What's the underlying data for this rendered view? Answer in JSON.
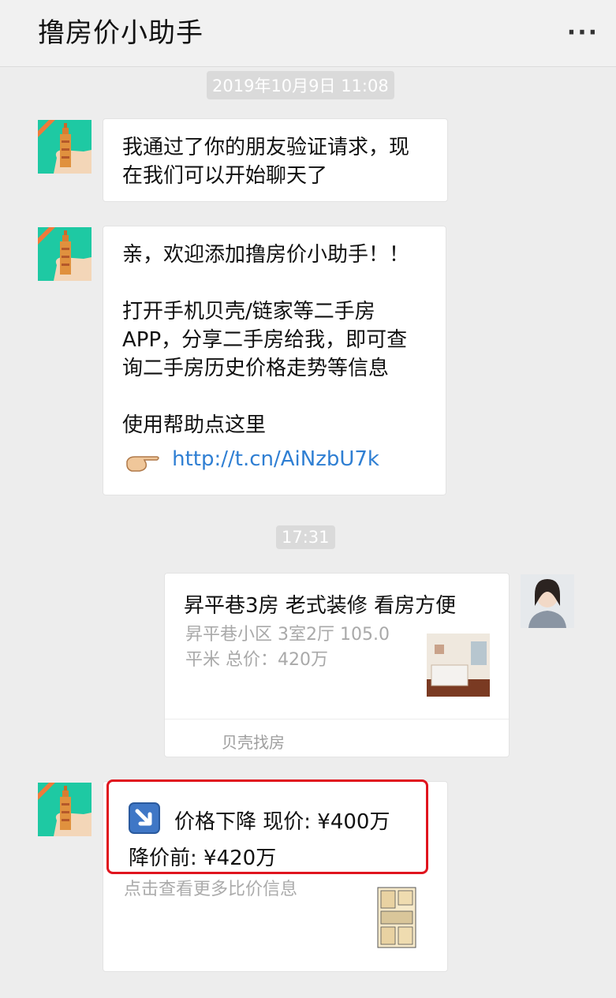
{
  "header": {
    "title": "撸房价小助手",
    "more_label": "···"
  },
  "timestamps": {
    "first": "2019年10月9日 11:08",
    "second": "17:31"
  },
  "messages": {
    "m1": {
      "line1": "我通过了你的朋友验证请求，现",
      "line2": "在我们可以开始聊天了"
    },
    "m2": {
      "line1": "亲，欢迎添加撸房价小助手！！",
      "line2": "打开手机贝壳/链家等二手房",
      "line3": "APP，分享二手房给我，即可查",
      "line4": "询二手房历史价格走势等信息",
      "line5": "使用帮助点这里",
      "link_url": "http://t.cn/AiNzbU7k"
    },
    "card": {
      "title": "昇平巷3房  老式装修  看房方便",
      "desc_line1": "昇平巷小区 3室2厅 105.0",
      "desc_line2": "平米 总价：420万",
      "source": "贝壳找房"
    },
    "price": {
      "line1": "价格下降 现价: ¥400万",
      "line2": "降价前: ¥420万",
      "more": "点击查看更多比价信息"
    }
  },
  "colors": {
    "bot_avatar": "#1ec9a3",
    "link": "#2f7fd3",
    "highlight": "#e0141e"
  }
}
